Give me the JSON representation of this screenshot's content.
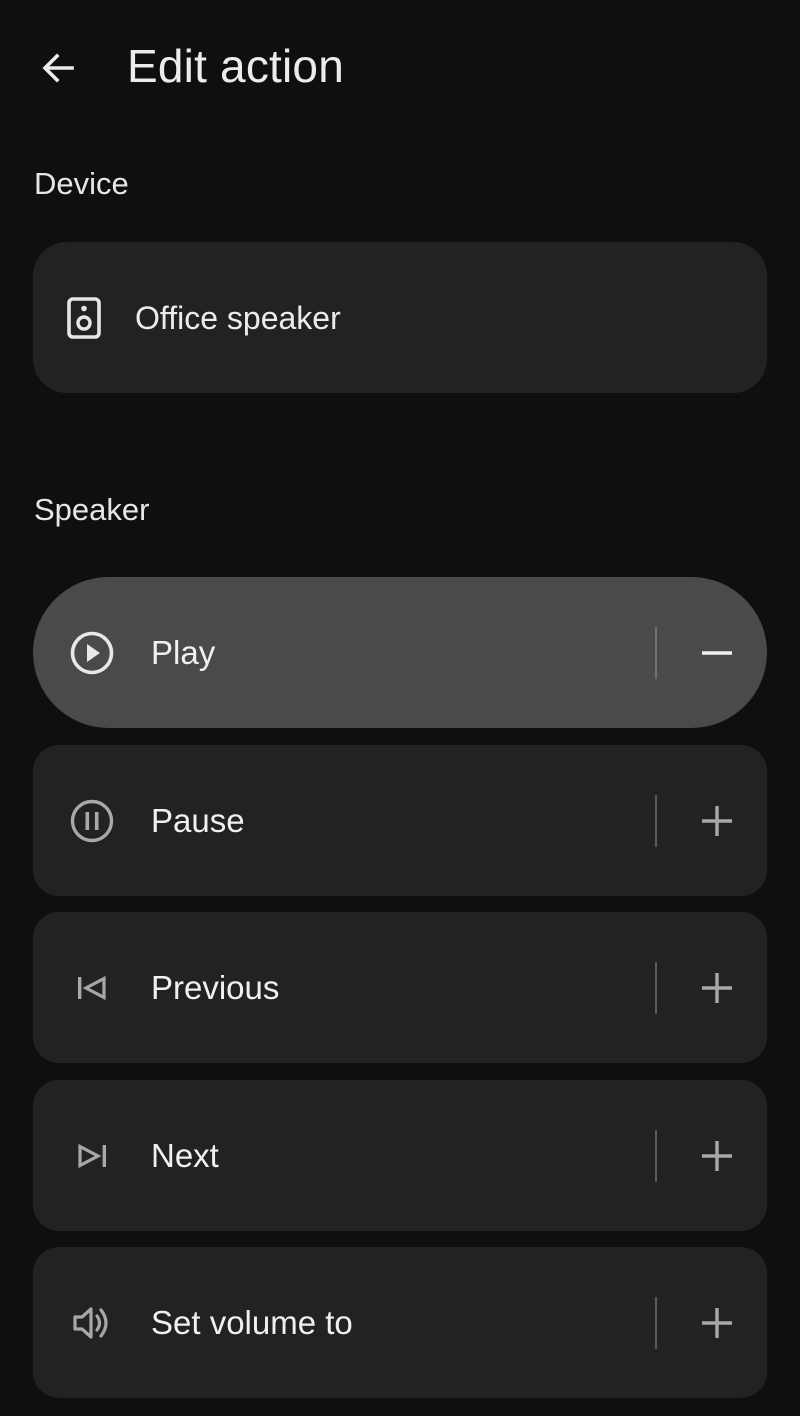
{
  "header": {
    "title": "Edit action",
    "back_icon": "arrow-back-icon"
  },
  "device_section": {
    "label": "Device",
    "device": {
      "name": "Office speaker",
      "icon": "speaker-icon"
    }
  },
  "speaker_section": {
    "label": "Speaker",
    "actions": [
      {
        "label": "Play",
        "icon": "play-circle-icon",
        "selected": true,
        "toggle_icon": "minus-icon"
      },
      {
        "label": "Pause",
        "icon": "pause-circle-icon",
        "selected": false,
        "toggle_icon": "plus-icon"
      },
      {
        "label": "Previous",
        "icon": "skip-previous-icon",
        "selected": false,
        "toggle_icon": "plus-icon"
      },
      {
        "label": "Next",
        "icon": "skip-next-icon",
        "selected": false,
        "toggle_icon": "plus-icon"
      },
      {
        "label": "Set volume to",
        "icon": "volume-icon",
        "selected": false,
        "toggle_icon": "plus-icon"
      }
    ]
  },
  "colors": {
    "background": "#0f0f0f",
    "card": "#222222",
    "selected_card": "#4a4a4a",
    "text": "#ececec"
  }
}
